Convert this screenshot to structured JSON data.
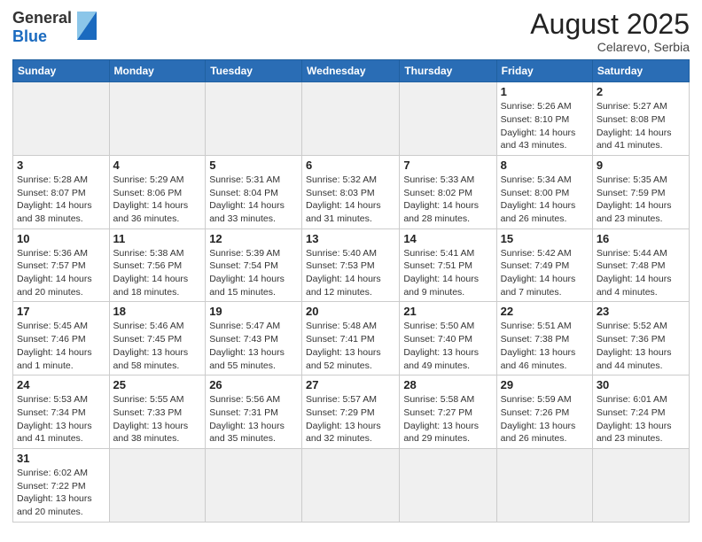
{
  "header": {
    "logo_general": "General",
    "logo_blue": "Blue",
    "title": "August 2025",
    "subtitle": "Celarevo, Serbia"
  },
  "days_of_week": [
    "Sunday",
    "Monday",
    "Tuesday",
    "Wednesday",
    "Thursday",
    "Friday",
    "Saturday"
  ],
  "weeks": [
    [
      {
        "num": "",
        "info": ""
      },
      {
        "num": "",
        "info": ""
      },
      {
        "num": "",
        "info": ""
      },
      {
        "num": "",
        "info": ""
      },
      {
        "num": "",
        "info": ""
      },
      {
        "num": "1",
        "info": "Sunrise: 5:26 AM\nSunset: 8:10 PM\nDaylight: 14 hours and 43 minutes."
      },
      {
        "num": "2",
        "info": "Sunrise: 5:27 AM\nSunset: 8:08 PM\nDaylight: 14 hours and 41 minutes."
      }
    ],
    [
      {
        "num": "3",
        "info": "Sunrise: 5:28 AM\nSunset: 8:07 PM\nDaylight: 14 hours and 38 minutes."
      },
      {
        "num": "4",
        "info": "Sunrise: 5:29 AM\nSunset: 8:06 PM\nDaylight: 14 hours and 36 minutes."
      },
      {
        "num": "5",
        "info": "Sunrise: 5:31 AM\nSunset: 8:04 PM\nDaylight: 14 hours and 33 minutes."
      },
      {
        "num": "6",
        "info": "Sunrise: 5:32 AM\nSunset: 8:03 PM\nDaylight: 14 hours and 31 minutes."
      },
      {
        "num": "7",
        "info": "Sunrise: 5:33 AM\nSunset: 8:02 PM\nDaylight: 14 hours and 28 minutes."
      },
      {
        "num": "8",
        "info": "Sunrise: 5:34 AM\nSunset: 8:00 PM\nDaylight: 14 hours and 26 minutes."
      },
      {
        "num": "9",
        "info": "Sunrise: 5:35 AM\nSunset: 7:59 PM\nDaylight: 14 hours and 23 minutes."
      }
    ],
    [
      {
        "num": "10",
        "info": "Sunrise: 5:36 AM\nSunset: 7:57 PM\nDaylight: 14 hours and 20 minutes."
      },
      {
        "num": "11",
        "info": "Sunrise: 5:38 AM\nSunset: 7:56 PM\nDaylight: 14 hours and 18 minutes."
      },
      {
        "num": "12",
        "info": "Sunrise: 5:39 AM\nSunset: 7:54 PM\nDaylight: 14 hours and 15 minutes."
      },
      {
        "num": "13",
        "info": "Sunrise: 5:40 AM\nSunset: 7:53 PM\nDaylight: 14 hours and 12 minutes."
      },
      {
        "num": "14",
        "info": "Sunrise: 5:41 AM\nSunset: 7:51 PM\nDaylight: 14 hours and 9 minutes."
      },
      {
        "num": "15",
        "info": "Sunrise: 5:42 AM\nSunset: 7:49 PM\nDaylight: 14 hours and 7 minutes."
      },
      {
        "num": "16",
        "info": "Sunrise: 5:44 AM\nSunset: 7:48 PM\nDaylight: 14 hours and 4 minutes."
      }
    ],
    [
      {
        "num": "17",
        "info": "Sunrise: 5:45 AM\nSunset: 7:46 PM\nDaylight: 14 hours and 1 minute."
      },
      {
        "num": "18",
        "info": "Sunrise: 5:46 AM\nSunset: 7:45 PM\nDaylight: 13 hours and 58 minutes."
      },
      {
        "num": "19",
        "info": "Sunrise: 5:47 AM\nSunset: 7:43 PM\nDaylight: 13 hours and 55 minutes."
      },
      {
        "num": "20",
        "info": "Sunrise: 5:48 AM\nSunset: 7:41 PM\nDaylight: 13 hours and 52 minutes."
      },
      {
        "num": "21",
        "info": "Sunrise: 5:50 AM\nSunset: 7:40 PM\nDaylight: 13 hours and 49 minutes."
      },
      {
        "num": "22",
        "info": "Sunrise: 5:51 AM\nSunset: 7:38 PM\nDaylight: 13 hours and 46 minutes."
      },
      {
        "num": "23",
        "info": "Sunrise: 5:52 AM\nSunset: 7:36 PM\nDaylight: 13 hours and 44 minutes."
      }
    ],
    [
      {
        "num": "24",
        "info": "Sunrise: 5:53 AM\nSunset: 7:34 PM\nDaylight: 13 hours and 41 minutes."
      },
      {
        "num": "25",
        "info": "Sunrise: 5:55 AM\nSunset: 7:33 PM\nDaylight: 13 hours and 38 minutes."
      },
      {
        "num": "26",
        "info": "Sunrise: 5:56 AM\nSunset: 7:31 PM\nDaylight: 13 hours and 35 minutes."
      },
      {
        "num": "27",
        "info": "Sunrise: 5:57 AM\nSunset: 7:29 PM\nDaylight: 13 hours and 32 minutes."
      },
      {
        "num": "28",
        "info": "Sunrise: 5:58 AM\nSunset: 7:27 PM\nDaylight: 13 hours and 29 minutes."
      },
      {
        "num": "29",
        "info": "Sunrise: 5:59 AM\nSunset: 7:26 PM\nDaylight: 13 hours and 26 minutes."
      },
      {
        "num": "30",
        "info": "Sunrise: 6:01 AM\nSunset: 7:24 PM\nDaylight: 13 hours and 23 minutes."
      }
    ],
    [
      {
        "num": "31",
        "info": "Sunrise: 6:02 AM\nSunset: 7:22 PM\nDaylight: 13 hours and 20 minutes."
      },
      {
        "num": "",
        "info": ""
      },
      {
        "num": "",
        "info": ""
      },
      {
        "num": "",
        "info": ""
      },
      {
        "num": "",
        "info": ""
      },
      {
        "num": "",
        "info": ""
      },
      {
        "num": "",
        "info": ""
      }
    ]
  ]
}
